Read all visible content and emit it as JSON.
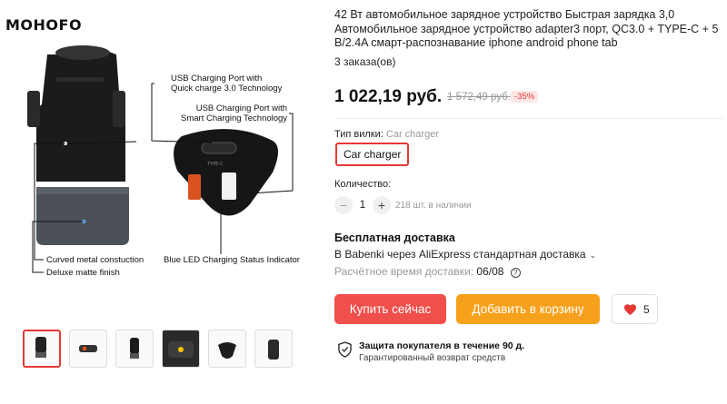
{
  "gallery": {
    "logo": "MOHOFO",
    "callouts": {
      "usb_qc": "USB Charging Port with\nQuick charge 3.0 Technology",
      "usb_smart": "USB Charging Port with\nSmart Charging Technology",
      "curved": "Curved metal constuction",
      "matte": "Deluxe matte finish",
      "led": "Blue LED Charging Status Indicator"
    },
    "thumbnails": [
      "thumb-1",
      "thumb-2",
      "thumb-3",
      "thumb-4",
      "thumb-5",
      "thumb-6"
    ],
    "active_thumb": 0
  },
  "product": {
    "title": "42 Вт автомобильное зарядное устройство Быстрая зарядка 3,0 Автомобильное зарядное устройство adapter3 порт, QC3.0 + TYPE-C + 5 В/2.4A смарт-распознавание iphone android phone tab",
    "orders": "3 заказа(ов)",
    "price": "1 022,19 руб.",
    "old_price": "1 572,49 руб.",
    "discount": "-35%",
    "plug_label": "Тип вилки:",
    "plug_value": "Car charger",
    "option": "Car charger",
    "qty_label": "Количество:",
    "qty_minus": "−",
    "qty_value": "1",
    "qty_plus": "+",
    "stock": "218 шт. в наличии"
  },
  "shipping": {
    "title": "Бесплатная доставка",
    "route": "В Babenki через AliExpress стандартная доставка",
    "chevron": "⌄",
    "eta_label": "Расчётное время доставки:",
    "eta_date": "06/08",
    "help": "?"
  },
  "actions": {
    "buy": "Купить сейчас",
    "cart": "Добавить в корзину",
    "wish_count": "5"
  },
  "protection": {
    "title": "Защита покупателя в течение 90 д.",
    "subtitle": "Гарантированный возврат средств"
  },
  "colors": {
    "buy": "#f04f4c",
    "cart": "#f7a01b",
    "accent": "#e53935"
  }
}
